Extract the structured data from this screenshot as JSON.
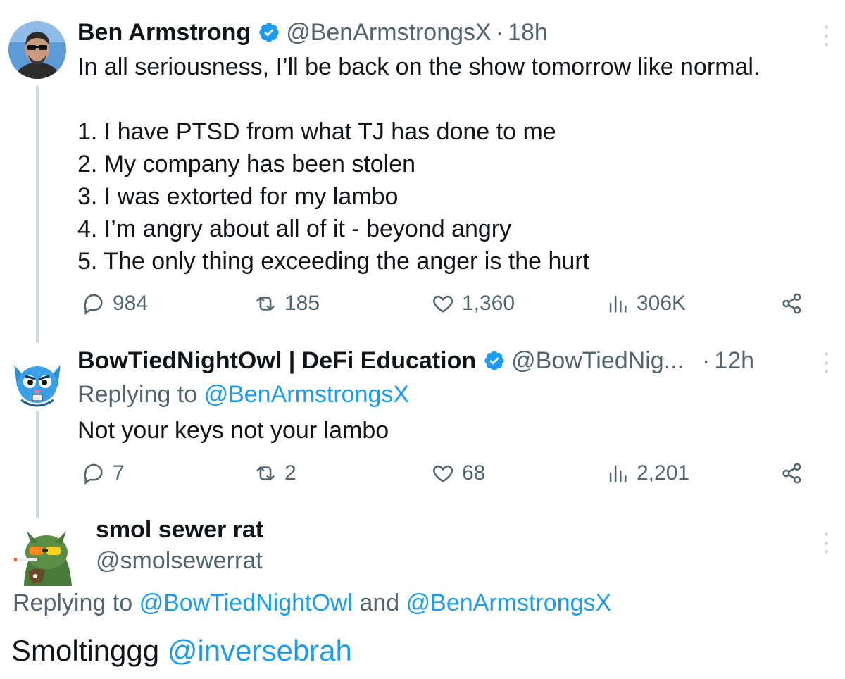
{
  "tweets": [
    {
      "author_name": "Ben Armstrong",
      "handle": "@BenArmstrongsX",
      "separator": "·",
      "time": "18h",
      "text_lines": [
        "In all seriousness, I’ll be back on the show tomorrow like normal.",
        "1. I have PTSD from what TJ has done to me",
        "2. My company has been stolen",
        "3. I was extorted for my lambo",
        "4. I’m angry about all of it - beyond angry",
        "5. The only thing exceeding the anger is the hurt"
      ],
      "stats": {
        "replies": "984",
        "reposts": "185",
        "likes": "1,360",
        "views": "306K"
      }
    },
    {
      "author_name": "BowTiedNightOwl | DeFi Education",
      "handle": "@BowTiedNig...",
      "separator": "·",
      "time": "12h",
      "replying_label": "Replying to",
      "replying_handle": "@BenArmstrongsX",
      "text": "Not your keys not your lambo",
      "stats": {
        "replies": "7",
        "reposts": "2",
        "likes": "68",
        "views": "2,201"
      }
    },
    {
      "author_name": "smol sewer rat",
      "handle": "@smolsewerrat",
      "replying_label": "Replying to",
      "replying_handle_1": "@BowTiedNightOwl",
      "replying_and": "and",
      "replying_handle_2": "@BenArmstrongsX",
      "text_prefix": "Smoltinggg",
      "text_mention": "@inversebrah"
    }
  ],
  "icons": {
    "verified": "verified-badge-icon",
    "reply": "reply-icon",
    "repost": "repost-icon",
    "like": "heart-icon",
    "views": "views-chart-icon",
    "share": "share-icon",
    "more": "more-options-icon"
  },
  "colors": {
    "link": "#1d9bf0",
    "muted": "#536471",
    "text": "#0f1419",
    "thread_line": "#cfd9de"
  }
}
